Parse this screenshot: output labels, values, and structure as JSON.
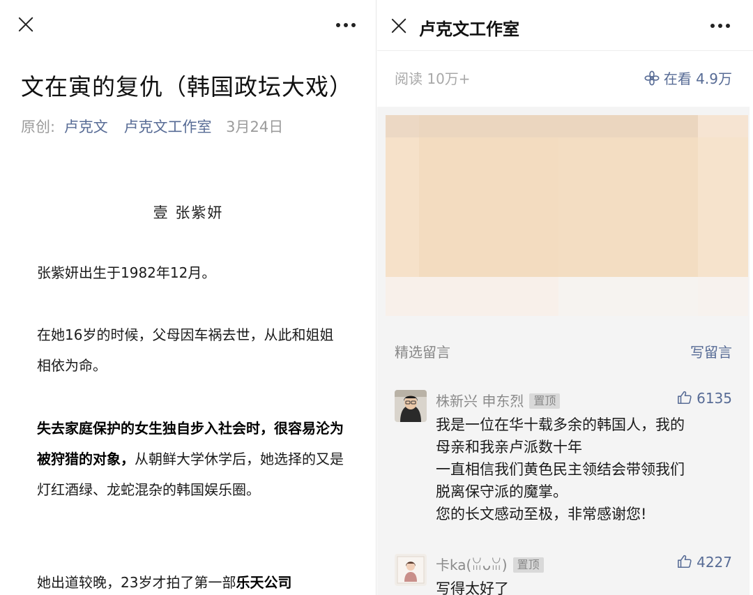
{
  "left": {
    "title": "文在寅的复仇（韩国政坛大戏）",
    "meta": {
      "original_label": "原创:",
      "author": "卢克文",
      "account": "卢克文工作室",
      "date": "3月24日"
    },
    "section_heading": "壹  张紫妍",
    "p1": "张紫妍出生于1982年12月。",
    "p2": "在她16岁的时候，父母因车祸去世，从此和姐姐相依为命。",
    "p3_bold": "失去家庭保护的女生独自步入社会时，很容易沦为被狩猎的对象，",
    "p3_rest": "从朝鲜大学休学后，她选择的又是灯红酒绿、龙蛇混杂的韩国娱乐圈。",
    "p4_start": "她出道较晚，23岁才拍了第一部",
    "p4_bold": "乐天公司"
  },
  "right": {
    "title": "卢克文工作室",
    "read_count": "阅读 10万+",
    "wow_count": "在看 4.9万",
    "selected_label": "精选留言",
    "write_label": "写留言",
    "comments": [
      {
        "name": "株新兴 申东烈",
        "pinned": "置顶",
        "likes": "6135",
        "lines": [
          "我是一位在华十载多余的韩国人，我的",
          "母亲和我亲卢派数十年",
          "一直相信我们黄色民主领结会带领我们",
          "脱离保守派的魔掌。",
          "您的长文感动至极，非常感谢您!"
        ]
      },
      {
        "name": "卡ka(ꈍᴗꈍ)",
        "pinned": "置顶",
        "likes": "4227",
        "lines": [
          "写得太好了"
        ]
      }
    ]
  },
  "colors": {
    "link": "#576b95",
    "meta_grey": "#9b9b9b",
    "panel_grey": "#f4f4f4"
  }
}
